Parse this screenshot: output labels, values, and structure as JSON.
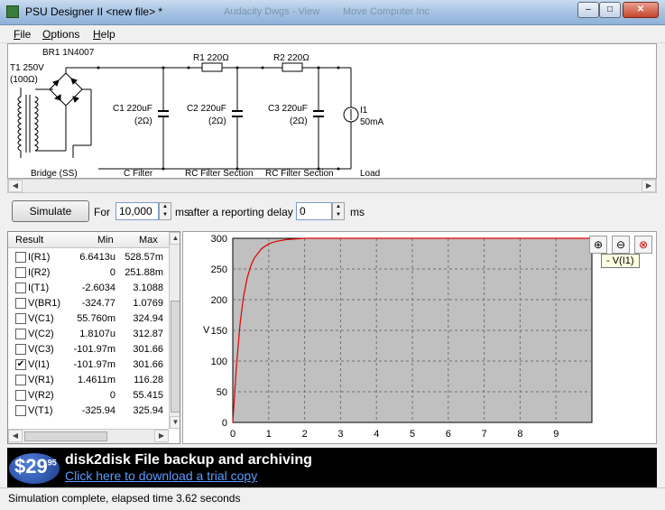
{
  "window": {
    "title": "PSU Designer II  <new file> *",
    "ghost_tab_1": "Audacity Dwgs - View",
    "ghost_tab_2": "Move Computer Inc"
  },
  "menu": [
    {
      "label": "File",
      "accel": "F",
      "rest": "ile"
    },
    {
      "label": "Options",
      "accel": "O",
      "rest": "ptions"
    },
    {
      "label": "Help",
      "accel": "H",
      "rest": "elp"
    }
  ],
  "schematic": {
    "transformer": {
      "name": "T1 250V",
      "resistance": "(100Ω)"
    },
    "rectifier": {
      "name": "BR1 1N4007"
    },
    "c1": {
      "name": "C1 220uF",
      "esr": "(2Ω)"
    },
    "r1": {
      "name": "R1 220Ω"
    },
    "c2": {
      "name": "C2 220uF",
      "esr": "(2Ω)"
    },
    "r2": {
      "name": "R2 220Ω"
    },
    "c3": {
      "name": "C3 220uF",
      "esr": "(2Ω)"
    },
    "load": {
      "name": "I1",
      "value": "50mA"
    },
    "sections": [
      "Bridge (SS)",
      "C Filter",
      "RC Filter Section",
      "RC Filter Section",
      "Load"
    ]
  },
  "controls": {
    "simulate_label": "Simulate",
    "for_label": "For",
    "duration_value": "10,000",
    "duration_unit": "ms",
    "delay_label": "after a reporting delay of",
    "delay_value": "0",
    "delay_unit": "ms"
  },
  "results": {
    "headers": [
      "Result",
      "Min",
      "Max"
    ],
    "rows": [
      {
        "name": "I(R1)",
        "min": "6.6413u",
        "max": "528.57m",
        "checked": false
      },
      {
        "name": "I(R2)",
        "min": "0",
        "max": "251.88m",
        "checked": false
      },
      {
        "name": "I(T1)",
        "min": "-2.6034",
        "max": "3.1088",
        "checked": false
      },
      {
        "name": "V(BR1)",
        "min": "-324.77",
        "max": "1.0769",
        "checked": false
      },
      {
        "name": "V(C1)",
        "min": "55.760m",
        "max": "324.94",
        "checked": false
      },
      {
        "name": "V(C2)",
        "min": "1.8107u",
        "max": "312.87",
        "checked": false
      },
      {
        "name": "V(C3)",
        "min": "-101.97m",
        "max": "301.66",
        "checked": false
      },
      {
        "name": "V(I1)",
        "min": "-101.97m",
        "max": "301.66",
        "checked": true
      },
      {
        "name": "V(R1)",
        "min": "1.4611m",
        "max": "116.28",
        "checked": false
      },
      {
        "name": "V(R2)",
        "min": "0",
        "max": "55.415",
        "checked": false
      },
      {
        "name": "V(T1)",
        "min": "-325.94",
        "max": "325.94",
        "checked": false
      }
    ]
  },
  "chart_data": {
    "type": "line",
    "ylabel": "V",
    "xlabel": "",
    "xlim": [
      0,
      10
    ],
    "ylim": [
      0,
      300
    ],
    "x_ticks": [
      "0",
      "1",
      "2",
      "3",
      "4",
      "5",
      "6",
      "7",
      "8",
      "9"
    ],
    "y_ticks": [
      "0",
      "50",
      "100",
      "150",
      "200",
      "250",
      "300"
    ],
    "grid": true,
    "series": [
      {
        "name": "V(I1)",
        "color": "#e00000",
        "x": [
          0,
          0.1,
          0.2,
          0.3,
          0.4,
          0.5,
          0.6,
          0.8,
          1.0,
          1.2,
          1.5,
          2.0,
          10.0
        ],
        "y": [
          0,
          90,
          160,
          205,
          235,
          255,
          268,
          283,
          291,
          295,
          298,
          300,
          300
        ]
      }
    ]
  },
  "zoom_tools": [
    "zoom-in-icon",
    "zoom-out-icon",
    "zoom-reset-icon"
  ],
  "tooltip": "- V(I1)",
  "banner": {
    "price": "$29",
    "price_cents": "95",
    "headline": "disk2disk File backup and archiving",
    "cta": "Click here to download a trial copy"
  },
  "status": "Simulation complete, elapsed time 3.62 seconds",
  "colors": {
    "trace": "#e00000",
    "plot_bg": "#c0c0c0",
    "banner_bg": "#000000"
  }
}
